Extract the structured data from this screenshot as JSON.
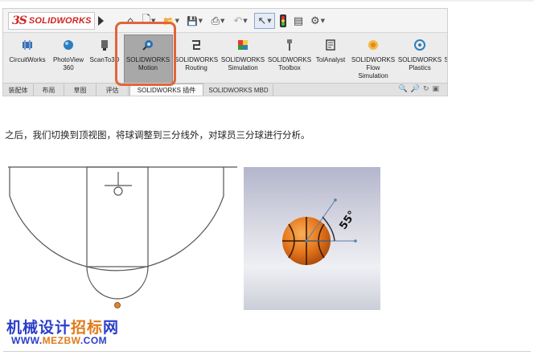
{
  "app": {
    "logo": "SOLIDWORKS",
    "logo_mark": "3S"
  },
  "quick_access": [
    {
      "icon": "home-icon",
      "glyph": "⌂"
    },
    {
      "icon": "new-document-icon",
      "glyph": "🗋"
    },
    {
      "icon": "open-folder-icon",
      "glyph": "📂"
    },
    {
      "icon": "save-icon",
      "glyph": "💾"
    },
    {
      "icon": "print-icon",
      "glyph": "⎙"
    },
    {
      "icon": "undo-icon",
      "glyph": "↶"
    },
    {
      "icon": "select-pointer-icon",
      "glyph": "↖"
    },
    {
      "icon": "traffic-light-icon",
      "glyph": "❚"
    },
    {
      "icon": "options-list-icon",
      "glyph": "▤"
    },
    {
      "icon": "gear-icon",
      "glyph": "⚙"
    }
  ],
  "ribbon_tools": [
    {
      "label": "CircuitWorks",
      "icon": "circuitworks-icon",
      "color": "#3a6fb5"
    },
    {
      "label": "PhotoView\n360",
      "icon": "photoview-icon",
      "color": "#2c7fbf"
    },
    {
      "label": "ScanTo3D",
      "icon": "scanto3d-icon",
      "color": "#555555"
    },
    {
      "label": "SOLIDWORKS\nMotion",
      "icon": "motion-icon",
      "color": "#2f6fb0"
    },
    {
      "label": "SOLIDWORKS\nRouting",
      "icon": "routing-icon",
      "color": "#444444"
    },
    {
      "label": "SOLIDWORKS\nSimulation",
      "icon": "simulation-icon",
      "color": "#2e9a3a"
    },
    {
      "label": "SOLIDWORKS\nToolbox",
      "icon": "toolbox-icon",
      "color": "#555555"
    },
    {
      "label": "TolAnalyst",
      "icon": "tolanalyst-icon",
      "color": "#444444"
    },
    {
      "label": "SOLIDWORKS\nFlow\nSimulation",
      "icon": "flow-simulation-icon",
      "color": "#e08a1a"
    },
    {
      "label": "SOLIDWORKS\nPlastics",
      "icon": "plastics-icon",
      "color": "#2c7fbf"
    },
    {
      "label": "S",
      "icon": "more-icon",
      "color": "#444444"
    }
  ],
  "tabs": [
    "装配体",
    "布局",
    "草图",
    "评估",
    "SOLIDWORKS 插件",
    "SOLIDWORKS MBD"
  ],
  "active_tab": "SOLIDWORKS 插件",
  "highlight_color": "#e0663a",
  "article": {
    "paragraph": "之后，我们切换到顶视图，将球调整到三分线外，对球员三分球进行分析。"
  },
  "ball_annotation": {
    "angle_label": "55°"
  },
  "watermark": {
    "title_blue": "机械设计",
    "title_orange": "招标",
    "title_blue2": "网",
    "url_blue": "WWW.",
    "url_orange": "MEZBW",
    "url_blue2": ".COM"
  }
}
